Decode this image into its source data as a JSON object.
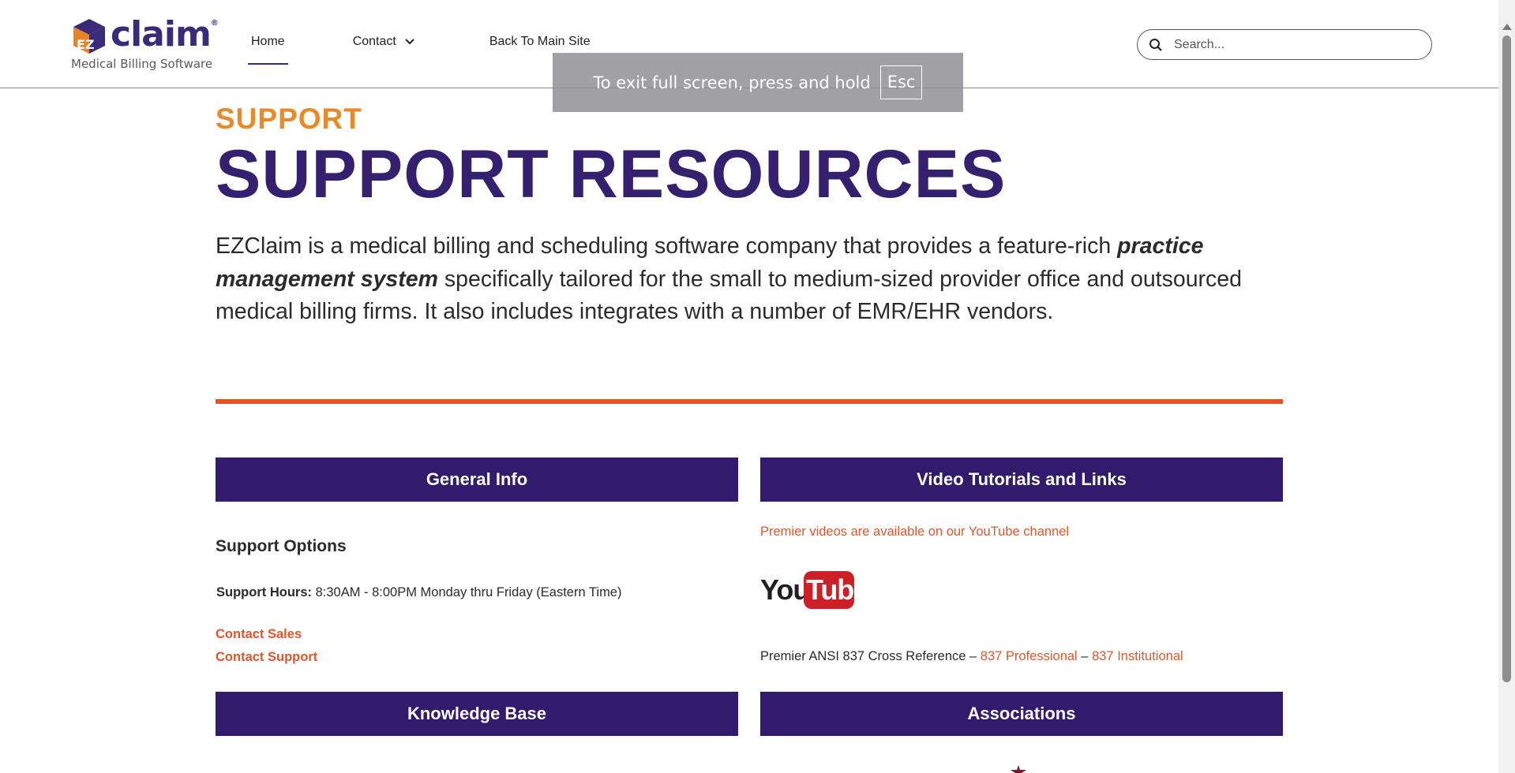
{
  "header": {
    "logo": {
      "brand": "claim",
      "mark": "EZ",
      "tagline": "Medical Billing Software"
    },
    "nav": [
      {
        "label": "Home",
        "active": true
      },
      {
        "label": "Contact",
        "has_dropdown": true
      },
      {
        "label": "Back To Main Site"
      }
    ],
    "search": {
      "placeholder": "Search...",
      "value": ""
    }
  },
  "toast": {
    "text": "To exit full screen, press and hold",
    "key": "Esc"
  },
  "hero": {
    "kicker": "SUPPORT",
    "title": "SUPPORT RESOURCES",
    "intro_part1": "EZClaim is a medical billing and scheduling software company that provides a feature-rich ",
    "intro_emphasis": "practice management system",
    "intro_part2": " specifically tailored for the small to medium-sized provider office and outsourced medical billing firms. It also includes integrates with a number of EMR/EHR vendors."
  },
  "general_info": {
    "header": "General Info",
    "options_title": "Support Options",
    "hours_label": "Support Hours:",
    "hours_value": " 8:30AM - 8:00PM Monday thru Friday (Eastern Time)",
    "links": [
      "Contact Sales",
      "Contact Support"
    ]
  },
  "videos": {
    "header": "Video Tutorials and Links",
    "youtube_text": "Premier videos are available on our YouTube channel",
    "youtube_logo": {
      "you": "You",
      "tube": "Tube"
    },
    "ansi_prefix": "Premier ANSI 837 Cross Reference – ",
    "ansi_link1": "837 Professional",
    "ansi_sep": " – ",
    "ansi_link2": "837 Institutional"
  },
  "knowledge_base": {
    "header": "Knowledge Base"
  },
  "associations": {
    "header": "Associations"
  },
  "colors": {
    "brand_purple": "#321b6d",
    "accent_orange": "#e0562a",
    "kicker_orange": "#e88a2a"
  }
}
